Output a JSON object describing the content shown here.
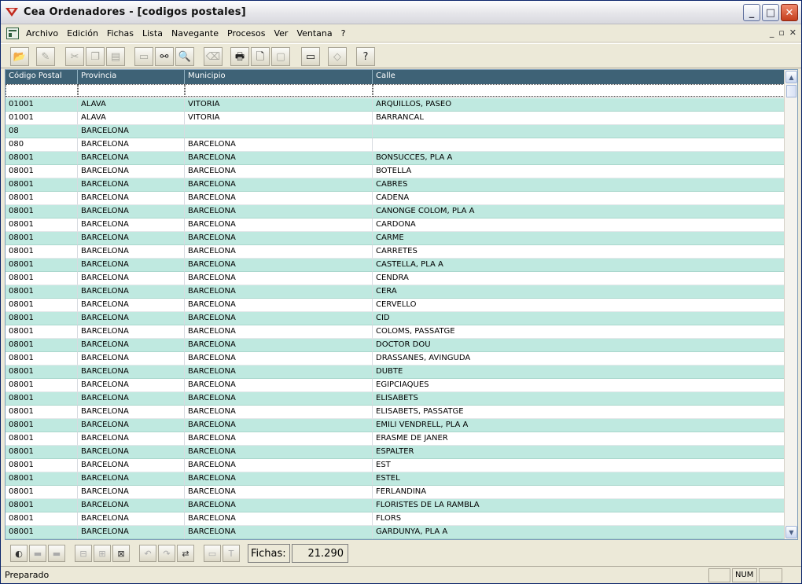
{
  "window": {
    "title": "Cea Ordenadores   - [codigos postales]",
    "minimize_glyph": "_",
    "maximize_glyph": "□",
    "close_glyph": "✕"
  },
  "menu": {
    "items": [
      "Archivo",
      "Edición",
      "Fichas",
      "Lista",
      "Navegante",
      "Procesos",
      "Ver",
      "Ventana",
      "?"
    ],
    "mdi_minimize": "_",
    "mdi_restore": "▫",
    "mdi_close": "✕"
  },
  "toolbar": {
    "buttons": [
      {
        "icon": "open-folder-icon",
        "glyph": "📂"
      },
      {
        "icon": "edit-document-icon",
        "glyph": "✎"
      },
      {
        "icon": "cut-icon",
        "glyph": "✂"
      },
      {
        "icon": "copy-icon",
        "glyph": "❐"
      },
      {
        "icon": "paste-icon",
        "glyph": "▤"
      },
      {
        "icon": "form-view-icon",
        "glyph": "▭"
      },
      {
        "icon": "binoculars-icon",
        "glyph": "⚯"
      },
      {
        "icon": "search-icon",
        "glyph": "🔍"
      },
      {
        "icon": "delete-icon",
        "glyph": "⌫"
      },
      {
        "icon": "print-icon",
        "glyph": "🖶"
      },
      {
        "icon": "print-preview-icon",
        "glyph": "🗋"
      },
      {
        "icon": "page-setup-icon",
        "glyph": "▢"
      },
      {
        "icon": "monitor-icon",
        "glyph": "▭"
      },
      {
        "icon": "eraser-icon",
        "glyph": "◇"
      },
      {
        "icon": "help-icon",
        "glyph": "?"
      }
    ]
  },
  "grid": {
    "columns": [
      "Código Postal",
      "Provincia",
      "Municipio",
      "Calle"
    ],
    "rows": [
      [
        "01001",
        "ALAVA",
        "VITORIA",
        "ARQUILLOS, PASEO"
      ],
      [
        "01001",
        "ALAVA",
        "VITORIA",
        "BARRANCAL"
      ],
      [
        "08",
        "BARCELONA",
        "",
        ""
      ],
      [
        "080",
        "BARCELONA",
        "BARCELONA",
        ""
      ],
      [
        "08001",
        "BARCELONA",
        "BARCELONA",
        "BONSUCCES, PLA A"
      ],
      [
        "08001",
        "BARCELONA",
        "BARCELONA",
        "BOTELLA"
      ],
      [
        "08001",
        "BARCELONA",
        "BARCELONA",
        "CABRES"
      ],
      [
        "08001",
        "BARCELONA",
        "BARCELONA",
        "CADENA"
      ],
      [
        "08001",
        "BARCELONA",
        "BARCELONA",
        "CANONGE COLOM, PLA A"
      ],
      [
        "08001",
        "BARCELONA",
        "BARCELONA",
        "CARDONA"
      ],
      [
        "08001",
        "BARCELONA",
        "BARCELONA",
        "CARME"
      ],
      [
        "08001",
        "BARCELONA",
        "BARCELONA",
        "CARRETES"
      ],
      [
        "08001",
        "BARCELONA",
        "BARCELONA",
        "CASTELLA, PLA A"
      ],
      [
        "08001",
        "BARCELONA",
        "BARCELONA",
        "CENDRA"
      ],
      [
        "08001",
        "BARCELONA",
        "BARCELONA",
        "CERA"
      ],
      [
        "08001",
        "BARCELONA",
        "BARCELONA",
        "CERVELLO"
      ],
      [
        "08001",
        "BARCELONA",
        "BARCELONA",
        "CID"
      ],
      [
        "08001",
        "BARCELONA",
        "BARCELONA",
        "COLOMS, PASSATGE"
      ],
      [
        "08001",
        "BARCELONA",
        "BARCELONA",
        "DOCTOR DOU"
      ],
      [
        "08001",
        "BARCELONA",
        "BARCELONA",
        "DRASSANES, AVINGUDA"
      ],
      [
        "08001",
        "BARCELONA",
        "BARCELONA",
        "DUBTE"
      ],
      [
        "08001",
        "BARCELONA",
        "BARCELONA",
        "EGIPCIAQUES"
      ],
      [
        "08001",
        "BARCELONA",
        "BARCELONA",
        "ELISABETS"
      ],
      [
        "08001",
        "BARCELONA",
        "BARCELONA",
        "ELISABETS, PASSATGE"
      ],
      [
        "08001",
        "BARCELONA",
        "BARCELONA",
        "EMILI VENDRELL, PLA A"
      ],
      [
        "08001",
        "BARCELONA",
        "BARCELONA",
        "ERASME DE JANER"
      ],
      [
        "08001",
        "BARCELONA",
        "BARCELONA",
        "ESPALTER"
      ],
      [
        "08001",
        "BARCELONA",
        "BARCELONA",
        "EST"
      ],
      [
        "08001",
        "BARCELONA",
        "BARCELONA",
        "ESTEL"
      ],
      [
        "08001",
        "BARCELONA",
        "BARCELONA",
        "FERLANDINA"
      ],
      [
        "08001",
        "BARCELONA",
        "BARCELONA",
        "FLORISTES DE LA RAMBLA"
      ],
      [
        "08001",
        "BARCELONA",
        "BARCELONA",
        "FLORS"
      ],
      [
        "08001",
        "BARCELONA",
        "BARCELONA",
        "GARDUNYA, PLA A"
      ]
    ]
  },
  "nav": {
    "fichas_label": "Fichas:",
    "fichas_value": "21.290"
  },
  "status": {
    "text": "Preparado",
    "num_indicator": "NUM"
  },
  "colors": {
    "header_bg": "#3e6276",
    "row_alt": "#bfe9e0",
    "row_plain": "#ffffff"
  }
}
